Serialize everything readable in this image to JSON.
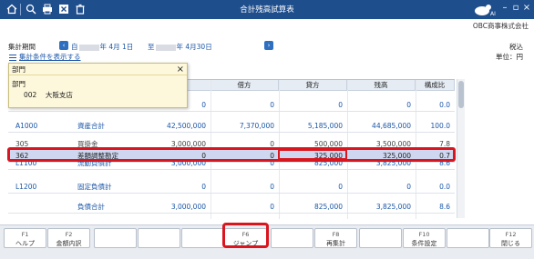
{
  "window": {
    "title": "合計残高試算表",
    "company": "OBC商事株式会社",
    "toolbar_icons": [
      "home-icon",
      "zoom-icon",
      "print-icon",
      "excel-icon",
      "delete-icon"
    ],
    "brand_color": "#1f4e8c",
    "highlight_color": "#d9151e"
  },
  "period": {
    "label": "集計期間",
    "from_prefix": "自",
    "from_date": "年  4月 1日",
    "to_prefix": "至",
    "to_date": "年  4月30日",
    "conditions_link": "集計条件を表示する"
  },
  "tax_mode": {
    "line1": "税込",
    "line2": "単位：円"
  },
  "table": {
    "columns": [
      "借方",
      "貸方",
      "残高",
      "構成比"
    ],
    "rows": [
      {
        "code": "",
        "name": "",
        "debit": "0",
        "credit": "0",
        "balance": "0",
        "ratio": "0.0"
      },
      {
        "code": "A1000",
        "name": "資産合計",
        "debit": "42,500,000",
        "credit": "7,370,000",
        "balance": "5,185,000",
        "ratio2": "44,685,000",
        "ratio": "100.0"
      },
      {
        "code": "305",
        "name": "買掛金",
        "debit": "3,000,000",
        "credit": "0",
        "balance": "500,000",
        "ratio2": "3,500,000",
        "ratio": "7.8"
      },
      {
        "code": "362",
        "name": "差額調整勘定",
        "debit": "0",
        "credit": "0",
        "balance": "325,000",
        "ratio2": "325,000",
        "ratio": "0.7"
      },
      {
        "code": "L1100",
        "name": "流動負債計",
        "debit": "3,000,000",
        "credit": "0",
        "balance": "825,000",
        "ratio2": "3,825,000",
        "ratio": "8.6"
      },
      {
        "code": "L1200",
        "name": "固定負債計",
        "debit": "0",
        "credit": "0",
        "balance": "0",
        "ratio2": "0",
        "ratio": "0.0"
      },
      {
        "code": "",
        "name": "負債合計",
        "debit": "3,000,000",
        "credit": "0",
        "balance": "825,000",
        "ratio2": "3,825,000",
        "ratio": "8.6"
      }
    ]
  },
  "popup": {
    "title": "部門",
    "sub_label": "部門",
    "dept_code": "002",
    "dept_name": "大阪支店"
  },
  "fkeys": [
    {
      "key": "F1",
      "label": "ヘルプ"
    },
    {
      "key": "F2",
      "label": "金額内訳"
    },
    {
      "key": "",
      "label": ""
    },
    {
      "key": "",
      "label": ""
    },
    {
      "key": "",
      "label": ""
    },
    {
      "key": "F6",
      "label": "ジャンプ"
    },
    {
      "key": "",
      "label": ""
    },
    {
      "key": "F8",
      "label": "再集計"
    },
    {
      "key": "",
      "label": ""
    },
    {
      "key": "F10",
      "label": "条件設定"
    },
    {
      "key": "",
      "label": ""
    },
    {
      "key": "F12",
      "label": "閉じる"
    }
  ]
}
